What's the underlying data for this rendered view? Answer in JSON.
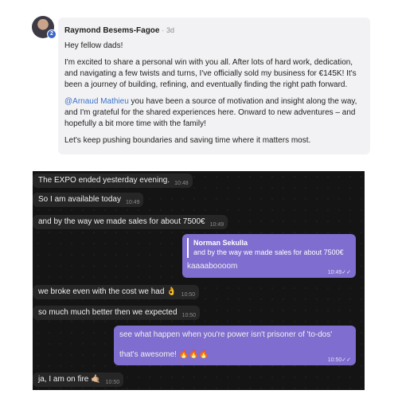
{
  "post": {
    "author": "Raymond Besems-Fagoe",
    "separator": "·",
    "time": "3d",
    "badge": "2",
    "greeting": "Hey fellow dads!",
    "paragraph1": "I'm excited to share a personal win with you all. After lots of hard work, dedication, and navigating a few twists and turns, I've officially sold my business for €145K! It's been a journey of building, refining, and eventually finding the right path forward.",
    "mention": "@Arnaud Mathieu",
    "paragraph2_rest": " you have been a source of motivation and insight along the way, and I'm grateful for the shared experiences here. Onward to new adventures – and hopefully a bit more time with the family!",
    "paragraph3": "Let's keep pushing boundaries and saving time where it matters most."
  },
  "chat": {
    "messages": [
      {
        "text": "The EXPO ended yesterday evening.",
        "time": "10:48"
      },
      {
        "text": "So I am available today",
        "time": "10:49"
      },
      {
        "text": "and by the way we made sales for about 7500€",
        "time": "10:49"
      },
      {
        "reply_name": "Norman Sekulla",
        "reply_quote": "and by the way we made sales for about 7500€",
        "text": "kaaaaboooom",
        "time": "10:49",
        "ticks": "✓✓"
      },
      {
        "text": "we broke even with the cost we had",
        "emoji": "👌",
        "time": "10:50"
      },
      {
        "text": "so much much better then we expected",
        "time": "10:50"
      },
      {
        "line1": "see what happen when you're power isn't prisoner of 'to-dos'",
        "line2": "that's awesome!",
        "emoji": "🔥🔥🔥",
        "time": "10:50",
        "ticks": "✓✓"
      },
      {
        "text": "ja, I am on fire",
        "emoji": "🤙🏼",
        "time": "10:50"
      }
    ]
  },
  "colors": {
    "outgoing_bubble": "#7f6dcf",
    "incoming_bubble": "#262626",
    "chat_background": "#141414",
    "post_bubble": "#f2f2f4",
    "mention": "#3b73c9"
  }
}
